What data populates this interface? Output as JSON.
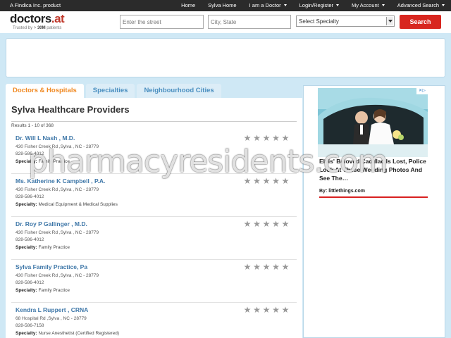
{
  "topbar": {
    "brand_line": "A Findica Inc. product",
    "nav": [
      {
        "label": "Home",
        "dropdown": false
      },
      {
        "label": "Sylva Home",
        "dropdown": false
      },
      {
        "label": "I am a Doctor",
        "dropdown": true
      },
      {
        "label": "Login/Register",
        "dropdown": true
      },
      {
        "label": "My Account",
        "dropdown": true
      },
      {
        "label": "Advanced Search",
        "dropdown": true
      }
    ]
  },
  "header": {
    "logo_name": "doctors",
    "logo_dot": ".",
    "logo_tld": "at",
    "tagline_prefix": "Trusted by > ",
    "tagline_count": "30M",
    "tagline_suffix": " patients",
    "street_placeholder": "Enter the street",
    "city_placeholder": "City, State",
    "specialty_selected": "Select Specialty",
    "search_label": "Search"
  },
  "tabs": [
    {
      "label": "Doctors & Hospitals",
      "active": true
    },
    {
      "label": "Specialties",
      "active": false
    },
    {
      "label": "Neighbourhood Cities",
      "active": false
    }
  ],
  "main": {
    "title": "Sylva Healthcare Providers",
    "results": "Results 1 - 10 of 368",
    "specialty_label": "Specialty:",
    "providers": [
      {
        "name": "Dr. Will L Nash , M.D.",
        "address": "430 Fisher Creek Rd ,Sylva , NC - 28779",
        "phone": "828-586-4012",
        "specialty": "Family Practice",
        "rating": 0
      },
      {
        "name": "Ms. Katherine K Campbell , P.A.",
        "address": "430 Fisher Creek Rd ,Sylva , NC - 28779",
        "phone": "828-586-4012",
        "specialty": "Medical Equipment & Medical Supplies",
        "rating": 0
      },
      {
        "name": "Dr. Roy P Gallinger , M.D.",
        "address": "430 Fisher Creek Rd ,Sylva , NC - 28779",
        "phone": "828-586-4012",
        "specialty": "Family Practice",
        "rating": 0
      },
      {
        "name": "Sylva Family Practice, Pa",
        "address": "430 Fisher Creek Rd ,Sylva , NC - 28779",
        "phone": "828-586-4012",
        "specialty": "Family Practice",
        "rating": 0
      },
      {
        "name": "Kendra L Ruppert , CRNA",
        "address": "68 Hospital Rd ,Sylva , NC - 28779",
        "phone": "828-586-7158",
        "specialty": "Nurse Anesthetist (Certified Registered)",
        "rating": 0
      }
    ]
  },
  "side_ad": {
    "close_label": "✕▷",
    "text": "Elvis' Beloved Cadillac Is Lost, Police Look At These Wedding Photos And See The…",
    "source": "By: littlethings.com"
  },
  "watermark": "pharmacyresidents.com",
  "colors": {
    "accent_orange": "#f08a24",
    "link_blue": "#3e77a8",
    "search_red": "#d8261f",
    "page_bg": "#cfe8f5"
  }
}
